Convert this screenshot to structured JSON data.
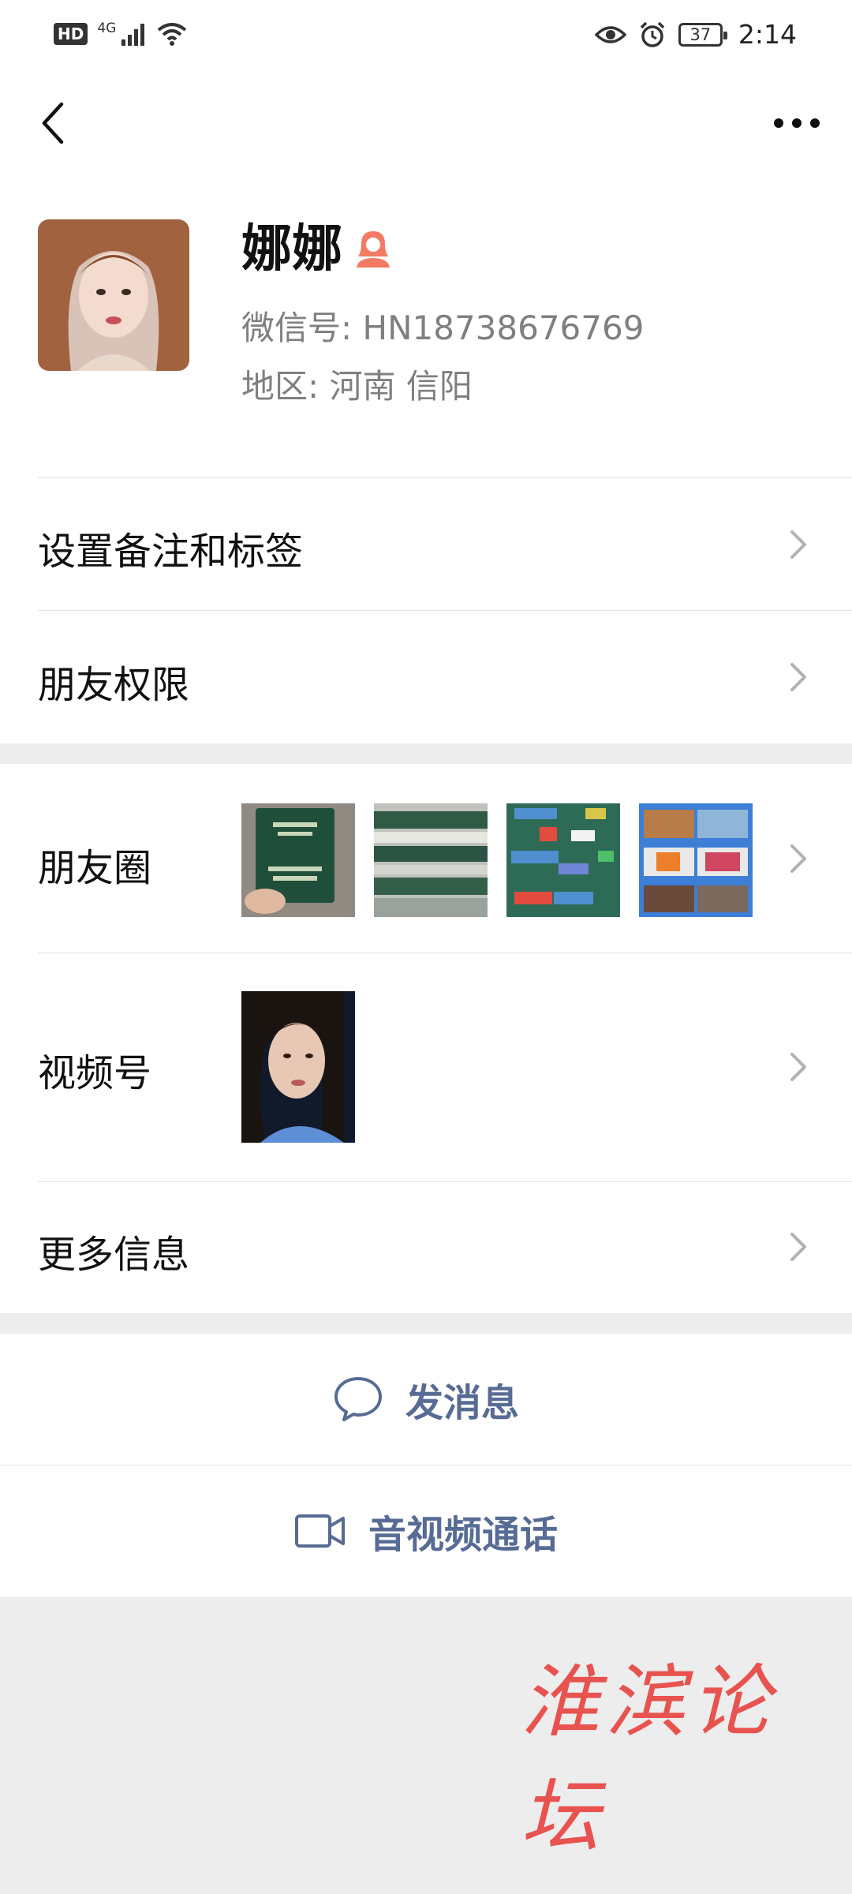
{
  "status_bar": {
    "hd": "HD",
    "network": "4G",
    "battery": "37",
    "time": "2:14"
  },
  "profile": {
    "name": "娜娜",
    "wechat_id": "微信号: HN18738676769",
    "region": "地区: 河南  信阳"
  },
  "menu": {
    "set_remark": "设置备注和标签",
    "friend_permission": "朋友权限",
    "moments": "朋友圈",
    "channels": "视频号",
    "more_info": "更多信息"
  },
  "actions": {
    "send_message": "发消息",
    "voice_video_call": "音视频通话"
  },
  "watermark": "淮滨论坛",
  "colors": {
    "link_blue": "#576b95",
    "gender_female": "#f37b63",
    "watermark_red": "#e8524f"
  }
}
